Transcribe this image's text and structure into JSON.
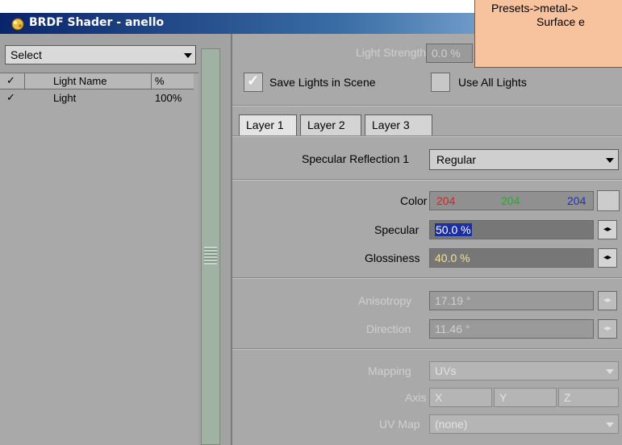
{
  "window": {
    "title": "BRDF Shader - anello"
  },
  "tooltip": {
    "line1": "Presets->metal->",
    "line2": "Surface e"
  },
  "left": {
    "select_label": "Select",
    "columns": {
      "check": "✓",
      "name": "Light Name",
      "pct": "%"
    },
    "rows": [
      {
        "check": "✓",
        "name": "Light",
        "pct": "100%"
      }
    ]
  },
  "right": {
    "light_strength_label": "Light Strength",
    "light_strength_value": "0.0 %",
    "save_lights_label": "Save Lights in Scene",
    "use_all_lights_label": "Use All Lights",
    "tabs": [
      "Layer 1",
      "Layer 2",
      "Layer 3"
    ],
    "specular_reflection_label": "Specular Reflection 1",
    "specular_reflection_value": "Regular",
    "color_label": "Color",
    "color_r": "204",
    "color_g": "204",
    "color_b": "204",
    "specular_label": "Specular",
    "specular_value": "50.0 %",
    "glossiness_label": "Glossiness",
    "glossiness_value": "40.0 %",
    "anisotropy_label": "Anisotropy",
    "anisotropy_value": "17.19 °",
    "direction_label": "Direction",
    "direction_value": "11.46 °",
    "mapping_label": "Mapping",
    "mapping_value": "UVs",
    "axis_label": "Axis",
    "axis_options": [
      "X",
      "Y",
      "Z"
    ],
    "uvmap_label": "UV Map",
    "uvmap_value": "(none)"
  },
  "colors": {
    "title_bar": "#0a246a",
    "tooltip_bg": "#f7c29e",
    "red": "#e02020",
    "green": "#20b020",
    "blue": "#2030c0",
    "highlight": "#1c2fa0"
  }
}
